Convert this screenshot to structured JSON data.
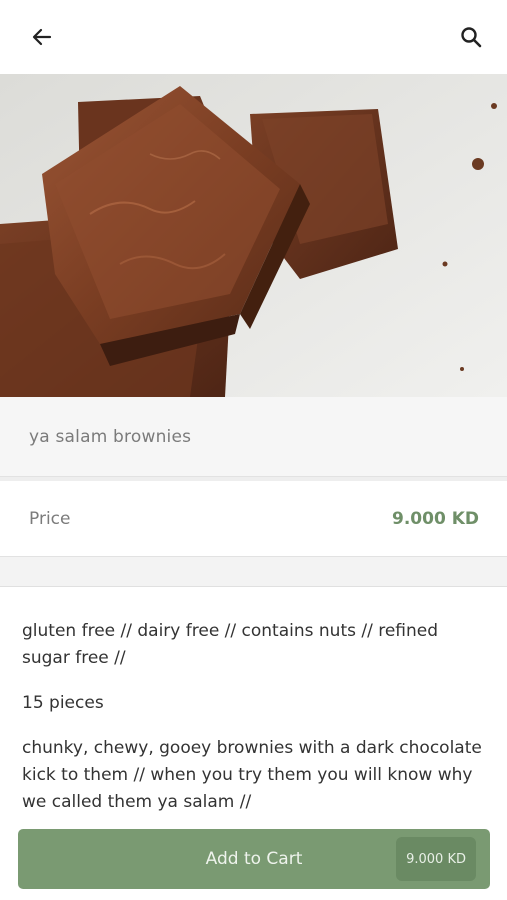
{
  "header": {
    "back_icon": "arrow-left-icon",
    "search_icon": "search-icon"
  },
  "product": {
    "image_alt": "brownies photo",
    "name": "ya salam brownies",
    "price_label": "Price",
    "price_value": "9.000 KD",
    "description": [
      "gluten free // dairy free // contains nuts // refined sugar free //",
      "15 pieces",
      "chunky, chewy, gooey brownies with a dark chocolate kick to them // when you try them you will know why we called them ya salam //"
    ]
  },
  "cart": {
    "label": "Add to Cart",
    "price": "9.000 KD"
  },
  "colors": {
    "accent": "#7a9a72",
    "price_text": "#6f8f68"
  }
}
